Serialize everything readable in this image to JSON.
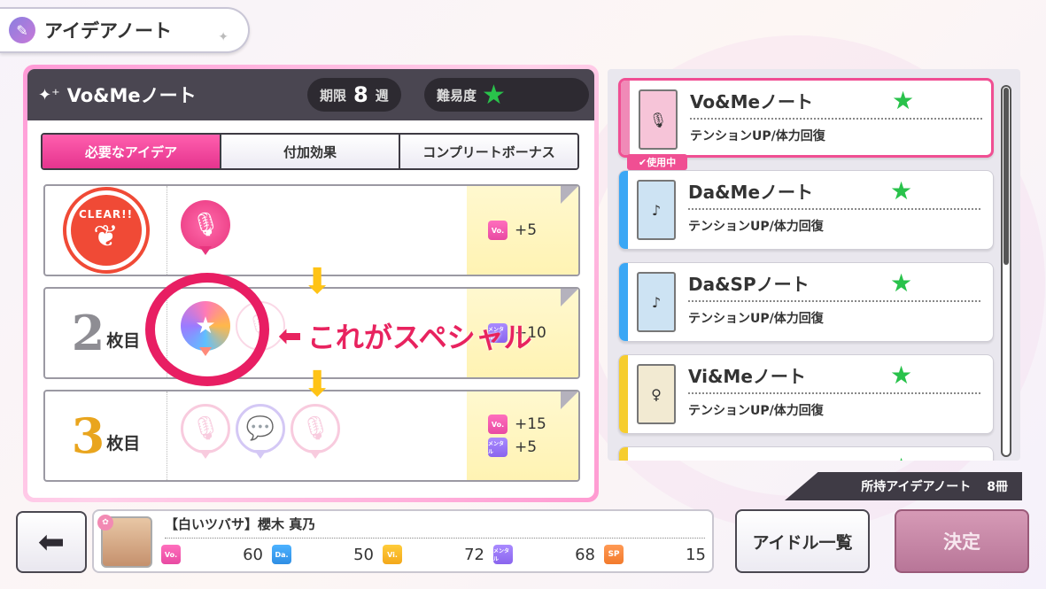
{
  "screen": {
    "title": "アイデアノート"
  },
  "note_panel": {
    "name": "Vo&Meノート",
    "period_label": "期限",
    "period_value": "8",
    "period_unit": "週",
    "difficulty_label": "難易度"
  },
  "tabs": [
    {
      "label": "必要なアイデア",
      "active": true
    },
    {
      "label": "付加効果",
      "active": false
    },
    {
      "label": "コンプリートボーナス",
      "active": false
    }
  ],
  "rows": [
    {
      "left_text": "CLEAR!!",
      "bonus": [
        {
          "stat": "Vo.",
          "value": "+5"
        }
      ]
    },
    {
      "ordinal": "2",
      "suffix": "枚目",
      "bonus": [
        {
          "stat": "メンタル",
          "value": "+10"
        }
      ]
    },
    {
      "ordinal": "3",
      "suffix": "枚目",
      "bonus": [
        {
          "stat": "Vo.",
          "value": "+15"
        },
        {
          "stat": "メンタル",
          "value": "+5"
        }
      ]
    }
  ],
  "annotation": {
    "text": "これがスペシャル"
  },
  "note_list": [
    {
      "name": "Vo&Meノート",
      "effect": "テンションUP/体力回復",
      "color": "#f08ab7",
      "selected": true
    },
    {
      "name": "Da&Meノート",
      "effect": "テンションUP/体力回復",
      "color": "#3aa7f5",
      "selected": false
    },
    {
      "name": "Da&SPノート",
      "effect": "テンションUP/体力回復",
      "color": "#3aa7f5",
      "selected": false
    },
    {
      "name": "Vi&Meノート",
      "effect": "テンションUP/体力回復",
      "color": "#f6cd2e",
      "selected": false
    }
  ],
  "in_use_label": "使用中",
  "owned": {
    "label": "所持アイデアノート",
    "count": "8冊"
  },
  "idol": {
    "name": "【白いツバサ】櫻木 真乃",
    "stats": [
      {
        "stat": "Vo.",
        "value": "60"
      },
      {
        "stat": "Da.",
        "value": "50"
      },
      {
        "stat": "Vi.",
        "value": "72"
      },
      {
        "stat": "メンタル",
        "value": "68"
      },
      {
        "stat": "SP",
        "value": "15"
      }
    ]
  },
  "buttons": {
    "idol_list": "アイドル一覧",
    "confirm": "決定"
  },
  "colors": {
    "accent_pink": "#f04f93",
    "star_green": "#29c24b",
    "ring_red": "#e81e63"
  }
}
